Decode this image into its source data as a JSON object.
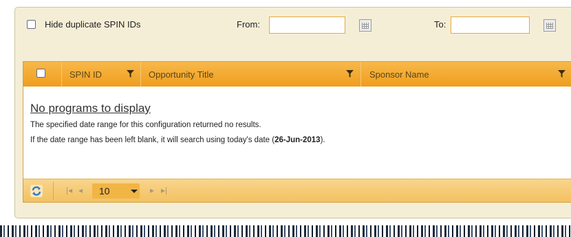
{
  "filter_bar": {
    "hide_duplicates_label": "Hide duplicate SPIN IDs",
    "hide_duplicates_checked": false,
    "from_label": "From:",
    "from_value": "",
    "to_label": "To:",
    "to_value": ""
  },
  "grid": {
    "columns": [
      {
        "label": "SPIN ID"
      },
      {
        "label": "Opportunity Title"
      },
      {
        "label": "Sponsor Name"
      }
    ],
    "empty_state": {
      "title": "No programs to display",
      "line1": "The specified date range for this configuration returned no results.",
      "line2_prefix": "If the date range has been left blank, it will search using today's date (",
      "line2_date": "26-Jun-2013",
      "line2_suffix": ")."
    },
    "pager": {
      "page_size": "10",
      "first_icon": "first-page-icon",
      "prev_icon": "prev-page-icon",
      "next_icon": "next-page-icon",
      "last_icon": "last-page-icon",
      "refresh_icon": "refresh-icon"
    }
  },
  "colors": {
    "header_orange": "#ef9e1d",
    "pager_yellow": "#f3c160",
    "panel_bg": "#f5eed7"
  }
}
